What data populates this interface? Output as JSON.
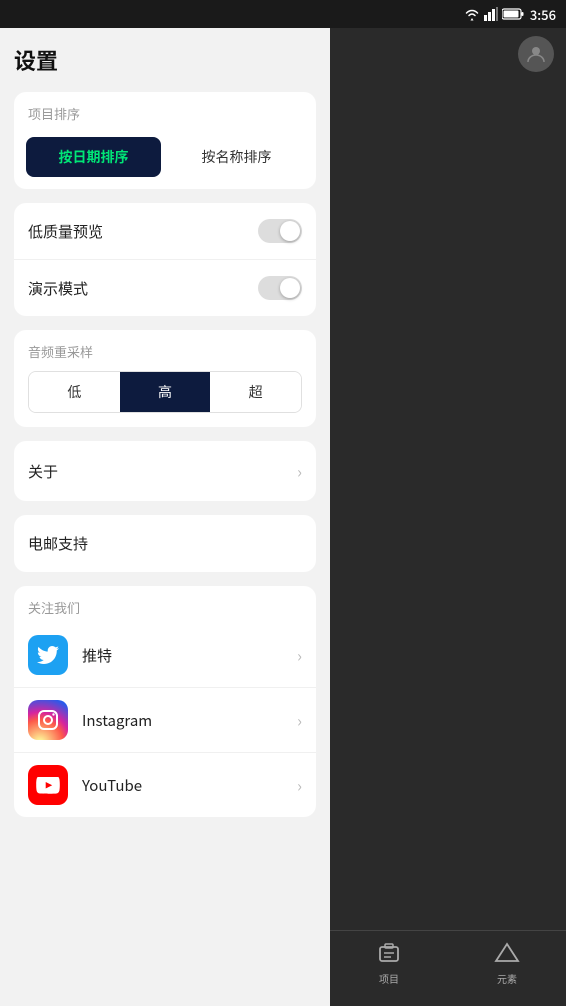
{
  "statusBar": {
    "time": "3:56",
    "wifiIcon": "wifi",
    "signalIcon": "signal",
    "batteryIcon": "battery"
  },
  "pageTitle": "设置",
  "sortSection": {
    "label": "项目排序",
    "buttons": [
      {
        "id": "by-date",
        "label": "按日期排序",
        "active": true
      },
      {
        "id": "by-name",
        "label": "按名称排序",
        "active": false
      }
    ]
  },
  "toggles": [
    {
      "id": "low-quality",
      "label": "低质量预览",
      "enabled": false
    },
    {
      "id": "demo-mode",
      "label": "演示模式",
      "enabled": false
    }
  ],
  "resampleSection": {
    "label": "音频重采样",
    "options": [
      {
        "id": "low",
        "label": "低",
        "active": false
      },
      {
        "id": "high",
        "label": "高",
        "active": true
      },
      {
        "id": "ultra",
        "label": "超",
        "active": false
      }
    ]
  },
  "aboutRow": {
    "label": "关于"
  },
  "emailRow": {
    "label": "电邮支持"
  },
  "followSection": {
    "label": "关注我们",
    "items": [
      {
        "id": "twitter",
        "name": "推特",
        "icon": "twitter"
      },
      {
        "id": "instagram",
        "name": "Instagram",
        "icon": "instagram"
      },
      {
        "id": "youtube",
        "name": "YouTube",
        "icon": "youtube"
      }
    ]
  },
  "rightPanel": {
    "navItems": [
      {
        "id": "projects",
        "label": "项目"
      },
      {
        "id": "elements",
        "label": "元素"
      }
    ]
  }
}
